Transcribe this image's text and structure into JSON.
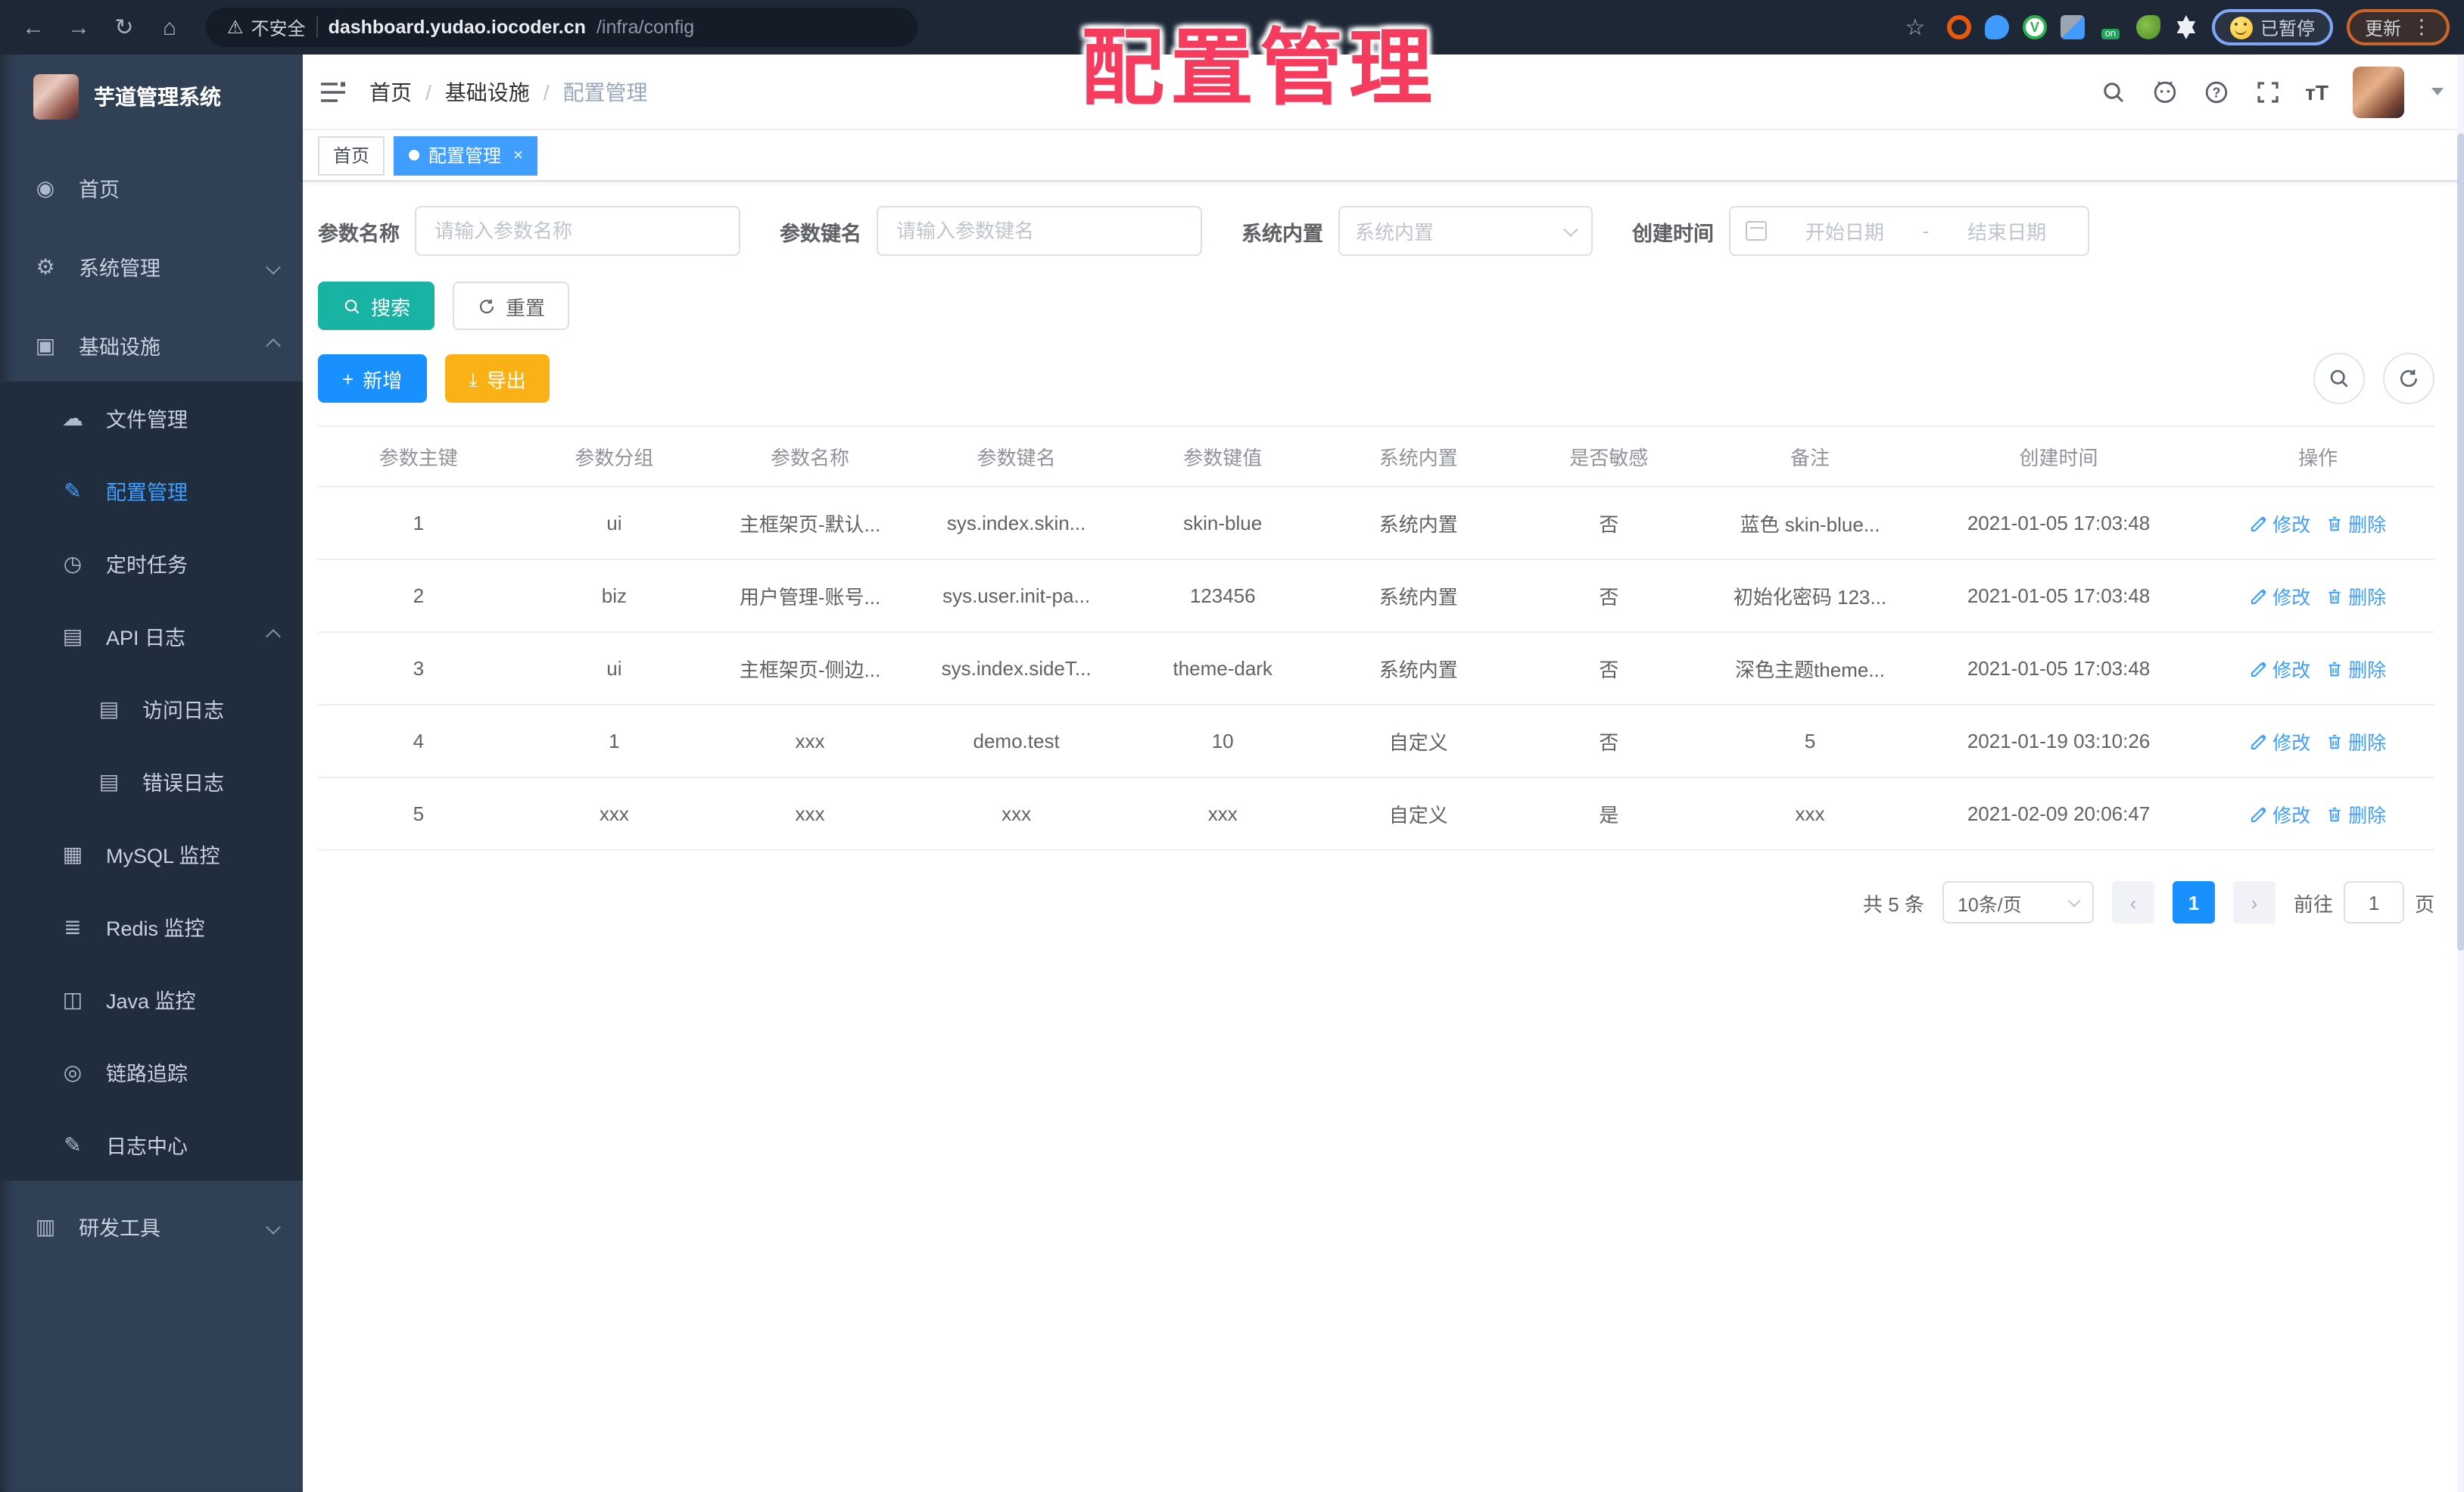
{
  "chrome": {
    "security": "不安全",
    "host": "dashboard.yudao.iocoder.cn",
    "path": "/infra/config",
    "paused_label": "已暂停",
    "update_label": "更新"
  },
  "overlay": {
    "title": "配置管理"
  },
  "sidebar": {
    "title": "芋道管理系统",
    "items": [
      {
        "label": "首页"
      },
      {
        "label": "系统管理"
      },
      {
        "label": "基础设施"
      },
      {
        "label": "文件管理"
      },
      {
        "label": "配置管理"
      },
      {
        "label": "定时任务"
      },
      {
        "label": "API 日志"
      },
      {
        "label": "访问日志"
      },
      {
        "label": "错误日志"
      },
      {
        "label": "MySQL 监控"
      },
      {
        "label": "Redis 监控"
      },
      {
        "label": "Java 监控"
      },
      {
        "label": "链路追踪"
      },
      {
        "label": "日志中心"
      },
      {
        "label": "研发工具"
      }
    ]
  },
  "navbar": {
    "breadcrumb": [
      "首页",
      "基础设施",
      "配置管理"
    ]
  },
  "tabs": [
    {
      "label": "首页"
    },
    {
      "label": "配置管理"
    }
  ],
  "filters": {
    "name_label": "参数名称",
    "name_placeholder": "请输入参数名称",
    "key_label": "参数键名",
    "key_placeholder": "请输入参数键名",
    "type_label": "系统内置",
    "type_placeholder": "系统内置",
    "time_label": "创建时间",
    "start_placeholder": "开始日期",
    "range_separator": "-",
    "end_placeholder": "结束日期"
  },
  "actions": {
    "search": "搜索",
    "reset": "重置",
    "add": "新增",
    "export": "导出"
  },
  "table": {
    "columns": [
      "参数主键",
      "参数分组",
      "参数名称",
      "参数键名",
      "参数键值",
      "系统内置",
      "是否敏感",
      "备注",
      "创建时间",
      "操作"
    ],
    "edit_label": "修改",
    "delete_label": "删除",
    "rows": [
      [
        "1",
        "ui",
        "主框架页-默认...",
        "sys.index.skin...",
        "skin-blue",
        "系统内置",
        "否",
        "蓝色 skin-blue...",
        "2021-01-05 17:03:48"
      ],
      [
        "2",
        "biz",
        "用户管理-账号...",
        "sys.user.init-pa...",
        "123456",
        "系统内置",
        "否",
        "初始化密码 123...",
        "2021-01-05 17:03:48"
      ],
      [
        "3",
        "ui",
        "主框架页-侧边...",
        "sys.index.sideT...",
        "theme-dark",
        "系统内置",
        "否",
        "深色主题theme...",
        "2021-01-05 17:03:48"
      ],
      [
        "4",
        "1",
        "xxx",
        "demo.test",
        "10",
        "自定义",
        "否",
        "5",
        "2021-01-19 03:10:26"
      ],
      [
        "5",
        "xxx",
        "xxx",
        "xxx",
        "xxx",
        "自定义",
        "是",
        "xxx",
        "2021-02-09 20:06:47"
      ]
    ]
  },
  "pagination": {
    "total": "共 5 条",
    "page_size": "10条/页",
    "current_page": "1",
    "goto_label": "前往",
    "page_unit": "页",
    "goto_value": "1"
  },
  "colors": {
    "accent": "#409eff",
    "search_teal": "#18b3a3",
    "export_yellow": "#f9b115",
    "overlay_red": "#f53b5e"
  }
}
